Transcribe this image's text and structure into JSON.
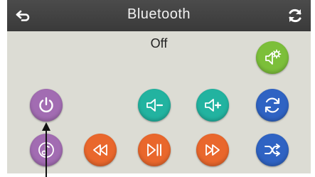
{
  "header": {
    "title": "Bluetooth",
    "back_icon": "back-arrow-icon",
    "refresh_icon": "refresh-icon"
  },
  "status": "Off",
  "buttons": [
    {
      "name": "pair-settings",
      "icon": "gear-speaker-icon",
      "color": "#7cbf3a"
    },
    {
      "name": "power",
      "icon": "power-icon",
      "color": "#a26cb2"
    },
    {
      "name": "volume-down",
      "icon": "volume-down-icon",
      "color": "#22b3a0"
    },
    {
      "name": "volume-up",
      "icon": "volume-up-icon",
      "color": "#22b3a0"
    },
    {
      "name": "repeat",
      "icon": "repeat-icon",
      "color": "#2f63c3"
    },
    {
      "name": "music",
      "icon": "music-note-icon",
      "color": "#a26cb2"
    },
    {
      "name": "previous",
      "icon": "rewind-icon",
      "color": "#e9672c"
    },
    {
      "name": "play-pause",
      "icon": "play-pause-icon",
      "color": "#e9672c"
    },
    {
      "name": "next",
      "icon": "fast-forward-icon",
      "color": "#e9672c"
    },
    {
      "name": "shuffle",
      "icon": "shuffle-icon",
      "color": "#2f63c3"
    }
  ]
}
